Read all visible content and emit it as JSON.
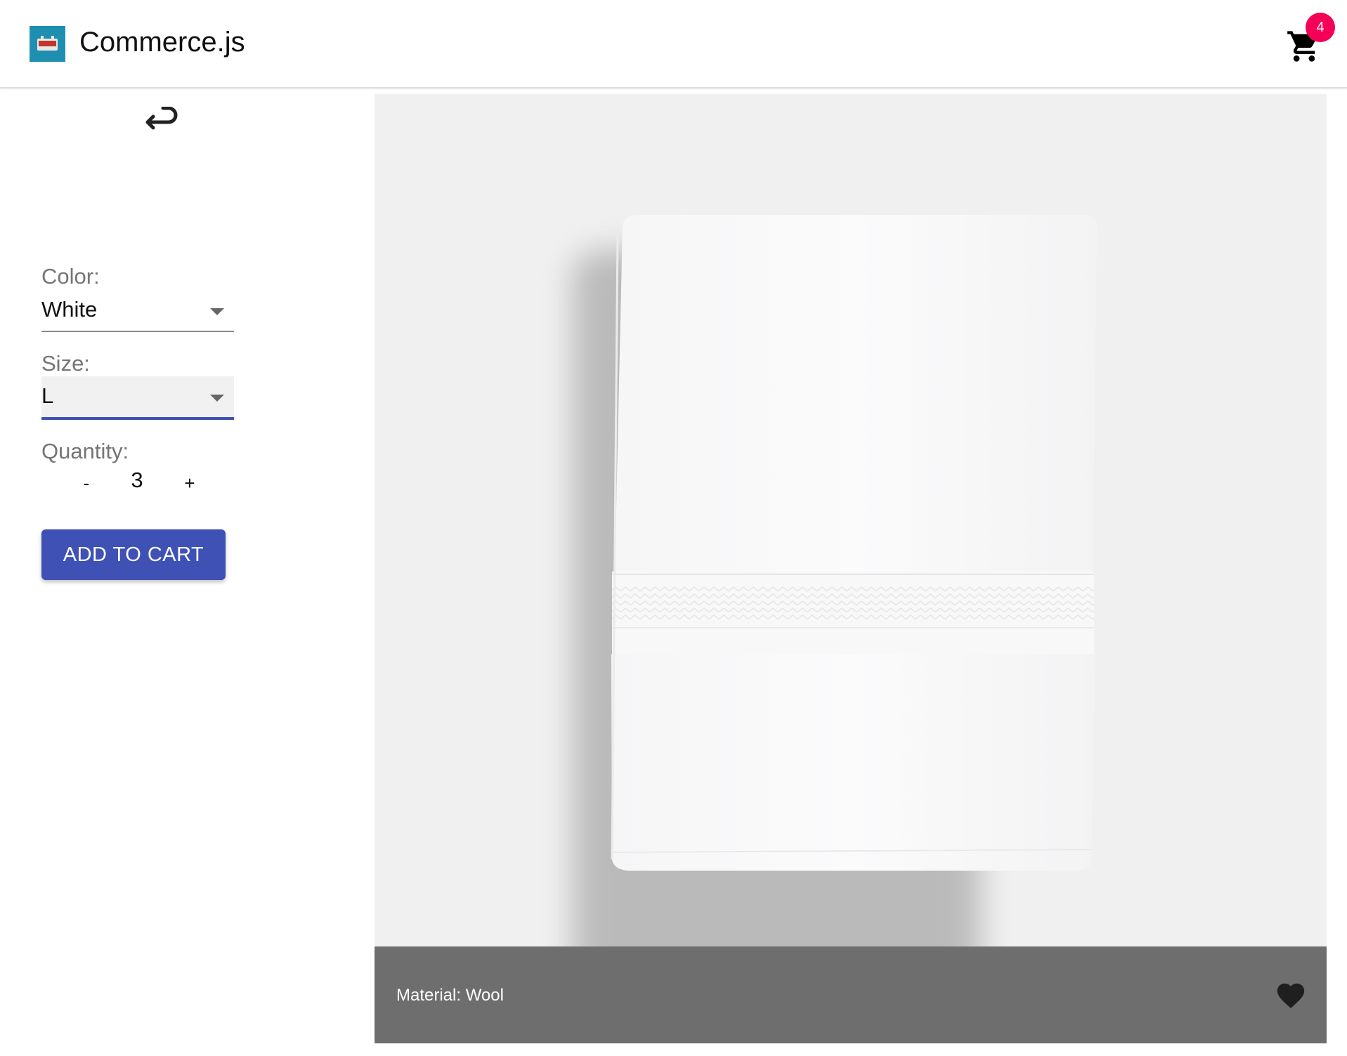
{
  "header": {
    "brand": "Commerce.js",
    "cart_count": "4",
    "logo_icon": "commerce-logo",
    "cart_icon": "shopping-cart-icon",
    "badge_color": "#f50057"
  },
  "back": {
    "icon": "return-arrow-icon"
  },
  "options": {
    "color_label": "Color:",
    "color_value": "White",
    "size_label": "Size:",
    "size_value": "L",
    "quantity_label": "Quantity:",
    "quantity_minus": "-",
    "quantity_value": "3",
    "quantity_plus": "+"
  },
  "actions": {
    "add_to_cart": "ADD TO CART",
    "accent_color": "#3f51b5"
  },
  "product": {
    "image_icon": "white-towel-image",
    "caption": "Material: Wool",
    "favorite_icon": "heart-icon"
  }
}
